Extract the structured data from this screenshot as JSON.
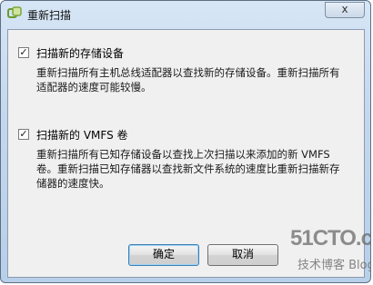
{
  "window": {
    "title": "重新扫描",
    "close_label": "x"
  },
  "options": [
    {
      "label": "扫描新的存储设备",
      "checked": true,
      "check_mark": "✓",
      "description": "重新扫描所有主机总线适配器以查找新的存储设备。重新扫描所有适配器的速度可能较慢。"
    },
    {
      "label": "扫描新的 VMFS 卷",
      "checked": true,
      "check_mark": "✓",
      "description": "重新扫描所有已知存储设备以查找上次扫描以来添加的新 VMFS 卷。重新扫描已知存储器以查找新文件系统的速度比重新扫描新存储器的速度快。"
    }
  ],
  "buttons": {
    "ok_label": "确定",
    "cancel_label": "取消"
  },
  "watermark": {
    "main": "51CTO.com",
    "sub": "技术博客 Blog"
  }
}
